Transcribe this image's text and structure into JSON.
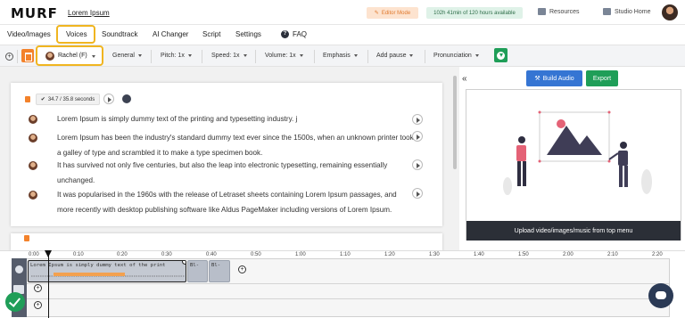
{
  "app": {
    "logo": "MURF",
    "project_title": "Lorem Ipsum",
    "editor_mode": "Editor Mode",
    "hours_available": "102h 41min of 120 hours available",
    "resources": "Resources",
    "studio_home": "Studio Home"
  },
  "tabs": [
    "Video/Images",
    "Voices",
    "Soundtrack",
    "AI Changer",
    "Script",
    "Settings",
    "FAQ"
  ],
  "toolbar": {
    "voice": "Rachel (F)",
    "general": "General",
    "pitch": "Pitch: 1x",
    "speed": "Speed: 1x",
    "volume": "Volume: 1x",
    "emphasis": "Emphasis",
    "add_pause": "Add pause",
    "pronunciation": "Pronunciation"
  },
  "block": {
    "duration": "34.7 / 35.8 seconds",
    "paragraphs": [
      "Lorem Ipsum is simply dummy text of the printing and typesetting industry. j",
      "Lorem Ipsum has been the industry's standard dummy text ever since the 1500s, when an unknown printer took a galley of type and scrambled it to make a type specimen book.",
      "It has survived not only five centuries, but also the leap into electronic typesetting, remaining essentially unchanged.",
      "It was popularised in the 1960s with the release of Letraset sheets containing Lorem Ipsum passages, and more recently with desktop publishing software like Aldus PageMaker including versions of Lorem Ipsum."
    ]
  },
  "preview": {
    "build_audio": "Build Audio",
    "export": "Export",
    "upload_hint": "Upload video/images/music from top menu"
  },
  "timeline": {
    "ticks": [
      "0:00",
      "0:10",
      "0:20",
      "0:30",
      "0:40",
      "0:50",
      "1:00",
      "1:10",
      "1:20",
      "1:30",
      "1:40",
      "1:50",
      "2:00",
      "2:10",
      "2:20"
    ],
    "clip_text": "Lorem Ipsum is simply dummy text of the print",
    "clip_tags": [
      "Bl-",
      "Bl-"
    ],
    "track_number": "1",
    "add_symbol": "+"
  },
  "colors": {
    "accent_blue": "#3575d3",
    "accent_green": "#1f9e58",
    "accent_orange": "#f3822b",
    "highlight_yellow": "#f0b520"
  }
}
